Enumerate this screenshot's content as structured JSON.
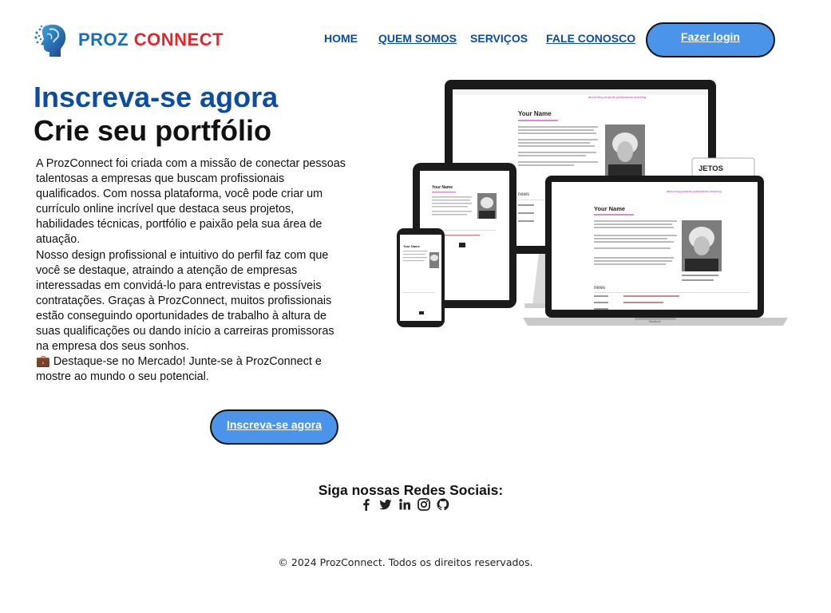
{
  "brand": {
    "name_part1": "PROZ",
    "name_part2": "CONNECT"
  },
  "nav": {
    "items": [
      {
        "label": "HOME"
      },
      {
        "label": "QUEM SOMOS"
      },
      {
        "label": "SERVIÇOS"
      },
      {
        "label": "FALE CONOSCO"
      }
    ],
    "login_label": "Fazer login"
  },
  "hero": {
    "title": "Inscreva-se agora",
    "subtitle": "Crie seu portfólio",
    "paragraphs": [
      "A ProzConnect foi criada com a missão de conectar pessoas talentosas a empresas que buscam profissionais qualificados. Com nossa plataforma, você pode criar um currículo online incrível que destaca seus projetos, habilidades técnicas, portfólio e paixão pela sua área de atuação.",
      "Nosso design profissional e intuitivo do perfil faz com que você se destaque, atraindo a atenção de empresas interessadas em convidá-lo para entrevistas e possíveis contratações. Graças à ProzConnect, muitos profissionais estão conseguindo oportunidades de trabalho à altura de suas qualificações ou dando início a carreiras promissoras na empresa dos seus sonhos.",
      "💼 Destaque-se no Mercado! Junte-se à ProzConnect e mostre ao mundo o seu potencial."
    ],
    "cta_label": "Inscreva-se agora"
  },
  "mockup": {
    "name_title": "Your Name",
    "section_news": "news",
    "projects_button": "JETOS",
    "laptop_brand": "MacBook"
  },
  "social": {
    "title": "Siga nossas Redes Sociais:",
    "icons": [
      "facebook-icon",
      "twitter-icon",
      "linkedin-icon",
      "instagram-icon",
      "github-icon"
    ]
  },
  "footer": {
    "text": "© 2024 ProzConnect. Todos os direitos reservados."
  },
  "colors": {
    "brand_blue": "#0c4da2",
    "brand_red": "#e3262b",
    "button_blue": "#4a94ea"
  }
}
